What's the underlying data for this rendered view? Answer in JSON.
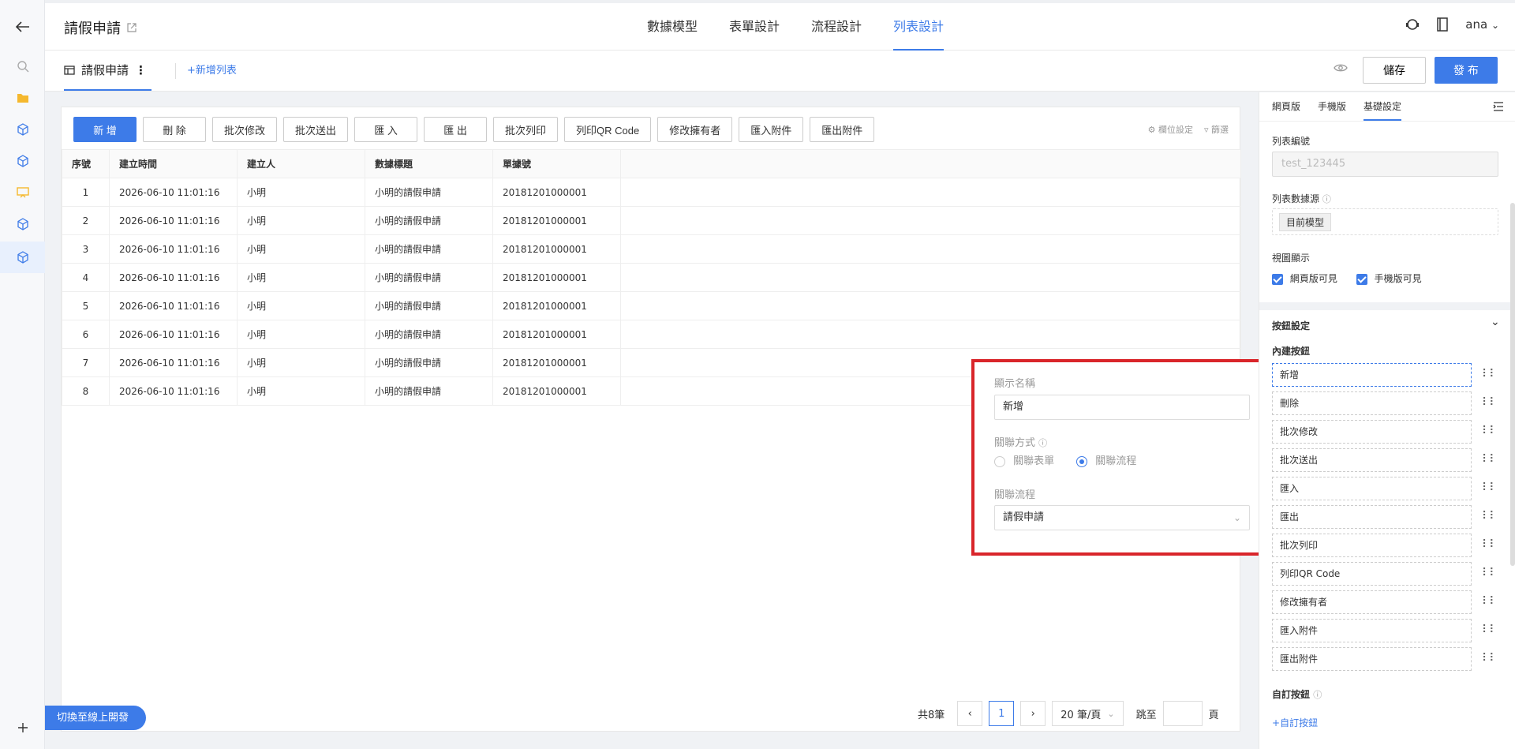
{
  "app": {
    "title": "請假申請"
  },
  "top_tabs": [
    "數據模型",
    "表單設計",
    "流程設計",
    "列表設計"
  ],
  "user": {
    "name": "ana"
  },
  "subbar": {
    "list_name": "請假申請",
    "add_list": "新增列表",
    "save": "儲存",
    "publish": "發 布"
  },
  "toolbar": {
    "buttons": [
      "新 增",
      "刪 除",
      "批次修改",
      "批次送出",
      "匯 入",
      "匯 出",
      "批次列印",
      "列印QR Code",
      "修改擁有者",
      "匯入附件",
      "匯出附件"
    ],
    "column_settings": "欄位設定",
    "filter": "篩選"
  },
  "table": {
    "columns": [
      "序號",
      "建立時間",
      "建立人",
      "數據標題",
      "單據號"
    ],
    "rows": [
      [
        "1",
        "2026-06-10 11:01:16",
        "小明",
        "小明的請假申請",
        "20181201000001"
      ],
      [
        "2",
        "2026-06-10 11:01:16",
        "小明",
        "小明的請假申請",
        "20181201000001"
      ],
      [
        "3",
        "2026-06-10 11:01:16",
        "小明",
        "小明的請假申請",
        "20181201000001"
      ],
      [
        "4",
        "2026-06-10 11:01:16",
        "小明",
        "小明的請假申請",
        "20181201000001"
      ],
      [
        "5",
        "2026-06-10 11:01:16",
        "小明",
        "小明的請假申請",
        "20181201000001"
      ],
      [
        "6",
        "2026-06-10 11:01:16",
        "小明",
        "小明的請假申請",
        "20181201000001"
      ],
      [
        "7",
        "2026-06-10 11:01:16",
        "小明",
        "小明的請假申請",
        "20181201000001"
      ],
      [
        "8",
        "2026-06-10 11:01:16",
        "小明",
        "小明的請假申請",
        "20181201000001"
      ]
    ]
  },
  "pager": {
    "total": "共8筆",
    "current": "1",
    "page_size": "20 筆/頁",
    "jump_label": "跳至",
    "page_suffix": "頁"
  },
  "switch_button": "切換至線上開發",
  "popup": {
    "display_name_label": "顯示名稱",
    "display_name_value": "新增",
    "link_mode_label": "關聯方式",
    "option_form": "關聯表單",
    "option_flow": "關聯流程",
    "link_flow_label": "關聯流程",
    "link_flow_value": "請假申請"
  },
  "right_panel": {
    "tabs": [
      "網頁版",
      "手機版",
      "基礎設定"
    ],
    "list_id_label": "列表編號",
    "list_id_value": "test_123445",
    "data_source_label": "列表數據源",
    "data_source_value": "目前模型",
    "view_label": "視圖顯示",
    "web_visible": "網頁版可見",
    "mobile_visible": "手機版可見",
    "button_settings": "按鈕設定",
    "builtin_buttons": "內建按鈕",
    "builtin_items": [
      "新增",
      "刪除",
      "批次修改",
      "批次送出",
      "匯入",
      "匯出",
      "批次列印",
      "列印QR Code",
      "修改擁有者",
      "匯入附件",
      "匯出附件"
    ],
    "custom_buttons": "自訂按鈕",
    "add_custom": "自訂按鈕"
  },
  "colors": {
    "accent": "#3d7be8",
    "highlight": "#d9252a"
  }
}
